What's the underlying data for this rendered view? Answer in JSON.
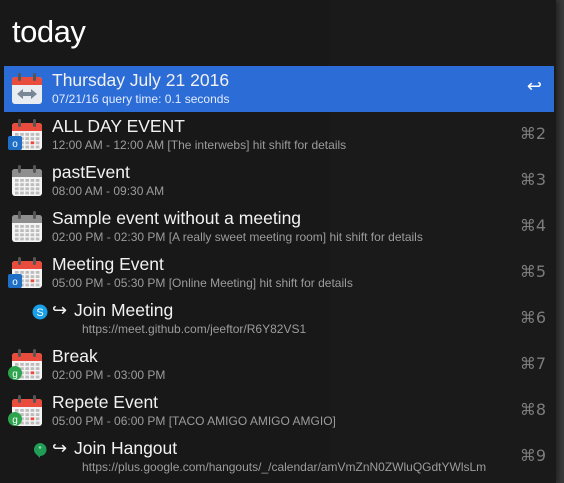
{
  "query": "today",
  "accent": "#2c6cd6",
  "items": [
    {
      "title": "Thursday July 21 2016",
      "subtitle": "07/21/16 query time: 0.1 seconds",
      "shortcut": "↩",
      "icon": "calendar-arrow-icon",
      "selected": true
    },
    {
      "title": "ALL DAY EVENT",
      "subtitle": "12:00 AM - 12:00 AM [The interwebs] hit shift for details",
      "shortcut": "⌘2",
      "icon": "calendar-icon",
      "badge": "outlook-icon"
    },
    {
      "title": "pastEvent",
      "subtitle": "08:00 AM - 09:30 AM",
      "shortcut": "⌘3",
      "icon": "calendar-gray-icon"
    },
    {
      "title": "Sample event without a meeting",
      "subtitle": "02:00 PM - 02:30 PM [A really sweet meeting room] hit shift for details",
      "shortcut": "⌘4",
      "icon": "calendar-gray-icon"
    },
    {
      "title": "Meeting Event",
      "subtitle": "05:00 PM - 05:30 PM [Online Meeting] hit shift for details",
      "shortcut": "⌘5",
      "icon": "calendar-icon",
      "badge": "outlook-icon"
    },
    {
      "title": "Join Meeting",
      "subtitle": "https://meet.github.com/jeeftor/R6Y82VS1",
      "shortcut": "⌘6",
      "icon": "skype-icon",
      "link": true
    },
    {
      "title": "Break",
      "subtitle": "02:00 PM - 03:00 PM",
      "shortcut": "⌘7",
      "icon": "calendar-icon",
      "badge": "google-icon"
    },
    {
      "title": "Repete Event",
      "subtitle": "05:00 PM - 06:00 PM [TACO AMIGO AMIGO AMGIO]",
      "shortcut": "⌘8",
      "icon": "calendar-icon",
      "badge": "google-icon"
    },
    {
      "title": "Join Hangout",
      "subtitle": "https://plus.google.com/hangouts/_/calendar/amVmZnN0ZWluQGdtYWlsLm",
      "shortcut": "⌘9",
      "icon": "hangouts-icon",
      "link": true
    }
  ]
}
